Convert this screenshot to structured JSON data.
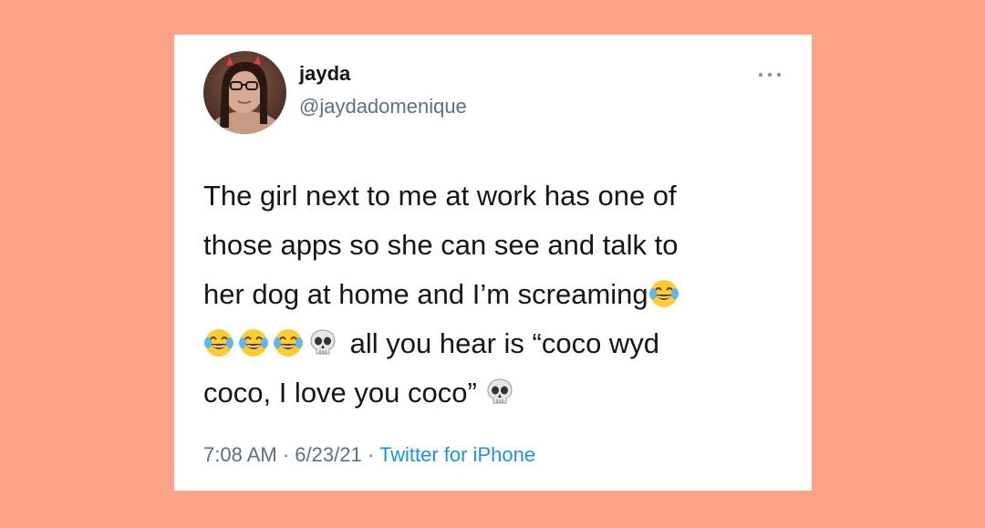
{
  "tweet": {
    "author_name": "jayda",
    "author_handle": "@jaydadomenique",
    "more_icon": "ellipsis-icon",
    "text_lines": {
      "line1": "The girl next to me at work has one of",
      "line2": "those apps so she can see and talk to",
      "line3": "her dog at home and I’m screaming",
      "line4": "all you hear is “coco wyd",
      "line5": "coco, I love you coco”"
    },
    "emojis": {
      "laughing": "face-with-tears-of-joy-icon",
      "skull": "skull-icon"
    },
    "time": "7:08 AM",
    "date": "6/23/21",
    "separator": "·",
    "source": "Twitter for iPhone"
  },
  "colors": {
    "background": "#FFA388",
    "card": "#FFFFFF",
    "text": "#14171A",
    "muted": "#5B7083",
    "link": "#1B95E0"
  }
}
